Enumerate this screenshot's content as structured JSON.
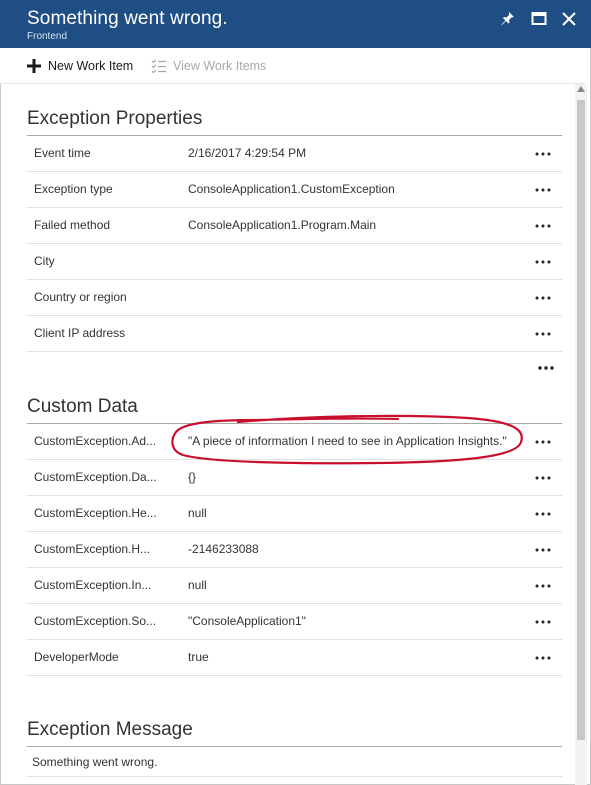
{
  "blade": {
    "title": "Something went wrong.",
    "subtitle": "Frontend",
    "header_color": "#1f4e84"
  },
  "toolbar": {
    "new_work_item": "New Work Item",
    "view_work_items": "View Work Items"
  },
  "exception_properties": {
    "heading": "Exception Properties",
    "rows": [
      {
        "label": "Event time",
        "value": "2/16/2017 4:29:54 PM"
      },
      {
        "label": "Exception type",
        "value": "ConsoleApplication1.CustomException"
      },
      {
        "label": "Failed method",
        "value": "ConsoleApplication1.Program.Main"
      },
      {
        "label": "City",
        "value": ""
      },
      {
        "label": "Country or region",
        "value": ""
      },
      {
        "label": "Client IP address",
        "value": ""
      }
    ]
  },
  "custom_data": {
    "heading": "Custom Data",
    "rows": [
      {
        "label": "CustomException.Ad...",
        "value": "\"A piece of information I need to see in Application Insights.\""
      },
      {
        "label": "CustomException.Da...",
        "value": "{}"
      },
      {
        "label": "CustomException.He...",
        "value": "null"
      },
      {
        "label": "CustomException.H...",
        "value": "-2146233088"
      },
      {
        "label": "CustomException.In...",
        "value": "null"
      },
      {
        "label": "CustomException.So...",
        "value": "\"ConsoleApplication1\""
      },
      {
        "label": "DeveloperMode",
        "value": "true"
      }
    ]
  },
  "exception_message": {
    "heading": "Exception Message",
    "text": "Something went wrong."
  },
  "annotation_color": "#c8102e",
  "icons": [
    "pin-icon",
    "maximize-icon",
    "close-icon",
    "plus-icon",
    "checklist-icon",
    "ellipsis-icon"
  ]
}
